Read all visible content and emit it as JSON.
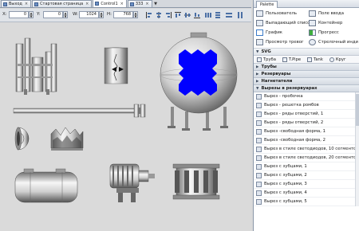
{
  "tabs": [
    {
      "label": "Выход",
      "active": false
    },
    {
      "label": "Стартовая страница",
      "active": false
    },
    {
      "label": "Control1",
      "active": true
    },
    {
      "label": "333",
      "active": false
    }
  ],
  "coords": {
    "x_label": "X:",
    "x_value": "0",
    "y_label": "Y:",
    "y_value": "0",
    "w_label": "W:",
    "w_value": "1024",
    "h_label": "H:",
    "h_value": "768"
  },
  "palette": {
    "title": "Palette",
    "components": [
      {
        "label": "Пользователь",
        "icon": "user-control-icon"
      },
      {
        "label": "Поле ввода",
        "icon": "textbox-icon"
      },
      {
        "label": "Выпадающий список",
        "icon": "combobox-icon"
      },
      {
        "label": "Контейнер",
        "icon": "container-icon"
      },
      {
        "label": "График",
        "icon": "chart-icon"
      },
      {
        "label": "Прогресс",
        "icon": "progress-icon"
      },
      {
        "label": "Просмотр тревог",
        "icon": "alarm-viewer-icon"
      },
      {
        "label": "Стрелочный инди",
        "icon": "gauge-icon"
      }
    ],
    "svg_header": "SVG",
    "svg_tabs": [
      {
        "label": "Труба"
      },
      {
        "label": "T.Pipe"
      },
      {
        "label": "Tank"
      },
      {
        "label": "Круг"
      }
    ],
    "categories": [
      "Трубы",
      "Резервуары",
      "Нагнетатели",
      "Вырезы в резервуарах"
    ],
    "items": [
      "Вырез - пробочка",
      "Вырез - решетка ромбов",
      "Вырез - ряды отверстий, 1",
      "Вырез - ряды отверстий, 2",
      "Вырез -свободная форма, 1",
      "Вырез -свободная форма, 2",
      "Вырез в стиле светодиодов, 10 сегментов",
      "Вырез в стиле светодиодов, 20 сегментов",
      "Вырез с зубцами, 1",
      "Вырез с зубцами, 2",
      "Вырез с зубцами, 3",
      "Вырез с зубцами, 4",
      "Вырез с зубцами, 5"
    ]
  },
  "colors": {
    "canvas_bg": "#dadada",
    "accent_blue": "#0000ff",
    "metal_light": "#f2f2f2",
    "metal_dark": "#6e6e6e"
  }
}
